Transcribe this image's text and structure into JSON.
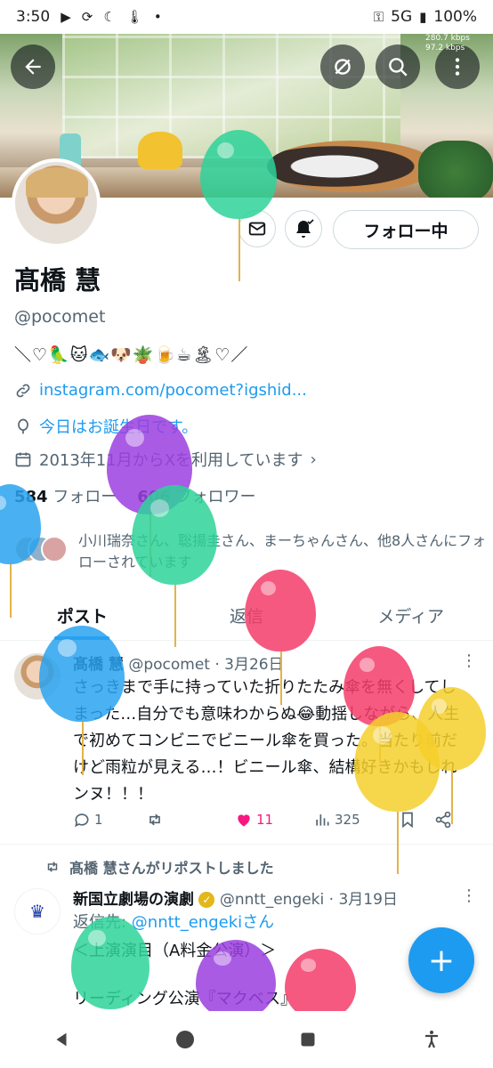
{
  "status_bar": {
    "time": "3:50",
    "network": "5G",
    "battery": "100%",
    "speed_down": "280.7 kbps",
    "speed_up": "97.2 kbps"
  },
  "header": {
    "back_icon": "arrow-left-icon",
    "icons": [
      "grok-icon",
      "search-icon",
      "more-vertical-icon"
    ]
  },
  "profile": {
    "name": "髙橋 慧",
    "handle": "@pocomet",
    "bio": "＼♡🦜🐱🐟🐶🪴🍺☕🏝♡／",
    "link": "instagram.com/pocomet?igshid...",
    "birthday": "今日はお誕生日です。",
    "joined": "2013年11月からXを利用しています",
    "following_count": "584",
    "following_label": "フォロー",
    "followers_count": "606",
    "followers_label": "フォロワー",
    "followed_by": "小川瑞奈さん、聡揚圭さん、まーちゃんさん、他8人さんにフォローされています",
    "follow_button": "フォロー中"
  },
  "tabs": [
    {
      "label": "ポスト",
      "active": true
    },
    {
      "label": "返信",
      "active": false
    },
    {
      "label": "メディア",
      "active": false
    }
  ],
  "posts": [
    {
      "author": "髙橋 慧",
      "handle": "@pocomet",
      "date": "3月26日",
      "text": "さっきまで手に持っていた折りたたみ傘を無くしてしまった…自分でも意味わからぬ😂動揺しながら、人生で初めてコンビニでビニール傘を買った。当たり前だけど雨粒が見える…！ビニール傘、結構好きかもしれンヌ！！！",
      "replies": "1",
      "reposts": "",
      "likes": "11",
      "views": "325"
    },
    {
      "repost_note": "髙橋 慧さんがリポストしました",
      "author": "新国立劇場の演劇",
      "handle": "@nntt_engeki",
      "date": "3月19日",
      "reply_prefix": "返信先: ",
      "reply_to": "@nntt_engekiさん",
      "line1": "＜上演演目（A料金公演）＞",
      "line2": "リーディング公演『マクベス』"
    }
  ],
  "fab": {
    "label": "+"
  },
  "colors": {
    "accent": "#1d9bf0",
    "like": "#f91880",
    "verified": "#e2b719"
  }
}
